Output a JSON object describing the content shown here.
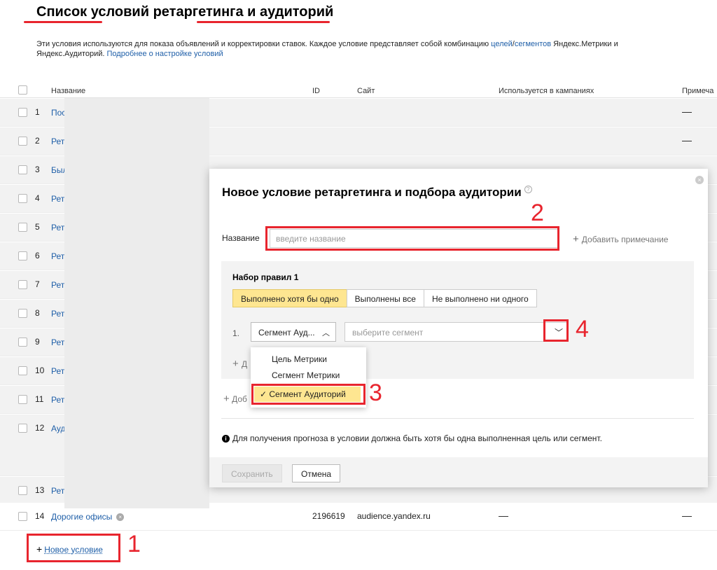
{
  "page": {
    "title": "Список условий ретаргетинга и аудиторий",
    "intro_line1": "Эти условия используются для показа объявлений и корректировки ставок. Каждое условие представляет собой комбинацию",
    "intro_link_goals": "целей",
    "intro_slash": "/",
    "intro_link_segments": "сегментов",
    "intro_line1_end": "Яндекс.Метрики и",
    "intro_line2": "Яндекс.Аудиторий.",
    "intro_link_more": "Подробнее о настройке условий"
  },
  "table": {
    "headers": {
      "name": "Название",
      "id": "ID",
      "site": "Сайт",
      "used": "Используется в кампаниях",
      "note": "Примеча"
    },
    "rows": [
      {
        "num": "1",
        "name": "Пос",
        "note": "—"
      },
      {
        "num": "2",
        "name": "Рет",
        "note": "—"
      },
      {
        "num": "3",
        "name": "Был",
        "note": "—"
      },
      {
        "num": "4",
        "name": "Рет"
      },
      {
        "num": "5",
        "name": "Рет"
      },
      {
        "num": "6",
        "name": "Рет"
      },
      {
        "num": "7",
        "name": "Рет"
      },
      {
        "num": "8",
        "name": "Рет"
      },
      {
        "num": "9",
        "name": "Рет"
      },
      {
        "num": "10",
        "name": "Рет"
      },
      {
        "num": "11",
        "name": "Рет"
      },
      {
        "num": "12",
        "name": "Ауд"
      },
      {
        "num": "13",
        "name": "Рет"
      },
      {
        "num": "14",
        "name": "Дорогие офисы",
        "id": "2196619",
        "site": "audience.yandex.ru",
        "used": "—",
        "note": "—"
      }
    ],
    "new_condition": "Новое условие"
  },
  "modal": {
    "title": "Новое условие ретаргетинга и подбора аудитории",
    "help": "?",
    "close": "×",
    "name_label": "Название",
    "name_placeholder": "введите название",
    "add_note": "Добавить примечание",
    "ruleset_title": "Набор правил 1",
    "modes": [
      "Выполнено хотя бы одно",
      "Выполнены все",
      "Не выполнено ни одного"
    ],
    "rule_num": "1.",
    "type_value": "Сегмент Ауд...",
    "segment_placeholder": "выберите сегмент",
    "add_rule_partial": "Д",
    "dropdown": [
      "Цель Метрики",
      "Сегмент Метрики",
      "✓ Сегмент Аудиторий"
    ],
    "add_set_partial": "Доб",
    "info": "Для получения прогноза в условии должна быть хотя бы одна выполненная цель или сегмент.",
    "save": "Сохранить",
    "cancel": "Отмена"
  },
  "annotations": [
    "1",
    "2",
    "3",
    "4"
  ],
  "colors": {
    "accent_red": "#e8252e",
    "link_blue": "#1f5fa8",
    "active_yellow": "#fee691"
  }
}
